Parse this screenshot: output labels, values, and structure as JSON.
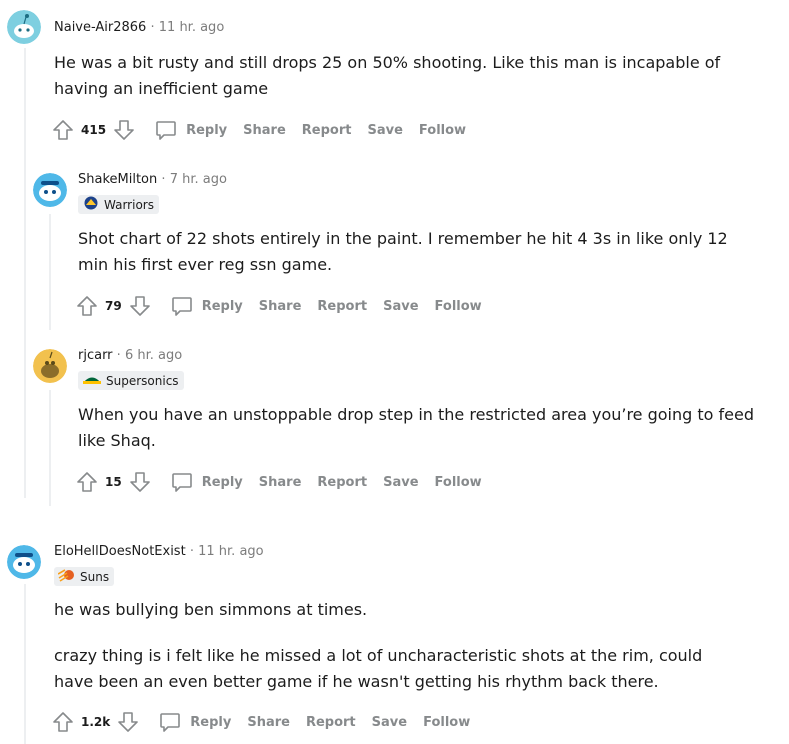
{
  "comments": [
    {
      "author": "Naive-Air2866",
      "time": "11 hr. ago",
      "avatar_color": "#7ecfe0",
      "flair": null,
      "paragraphs": [
        "He was a bit rusty and still drops 25 on 50% shooting. Like this man is incapable of having an inefficient game"
      ],
      "score": "415"
    },
    {
      "author": "ShakeMilton",
      "time": "7 hr. ago",
      "avatar_color": "#4fb8e8",
      "flair": {
        "label": "Warriors",
        "icon": "warriors-logo-icon"
      },
      "paragraphs": [
        "Shot chart of 22 shots entirely in the paint. I remember he hit 4 3s in like only 12 min his first ever reg ssn game."
      ],
      "score": "79"
    },
    {
      "author": "rjcarr",
      "time": "6 hr. ago",
      "avatar_color": "#f2c14e",
      "flair": {
        "label": "Supersonics",
        "icon": "supersonics-logo-icon"
      },
      "paragraphs": [
        "When you have an unstoppable drop step in the restricted area you’re going to feed like Shaq."
      ],
      "score": "15"
    },
    {
      "author": "EloHellDoesNotExist",
      "time": "11 hr. ago",
      "avatar_color": "#4fb8e8",
      "flair": {
        "label": "Suns",
        "icon": "suns-logo-icon"
      },
      "paragraphs": [
        "he was bullying ben simmons at times.",
        "crazy thing is i felt like he missed a lot of uncharacteristic shots at the rim, could have been an even better game if he wasn't getting his rhythm back there."
      ],
      "score": "1.2k"
    }
  ],
  "actions": {
    "reply": "Reply",
    "share": "Share",
    "report": "Report",
    "save": "Save",
    "follow": "Follow"
  },
  "separator": "·"
}
